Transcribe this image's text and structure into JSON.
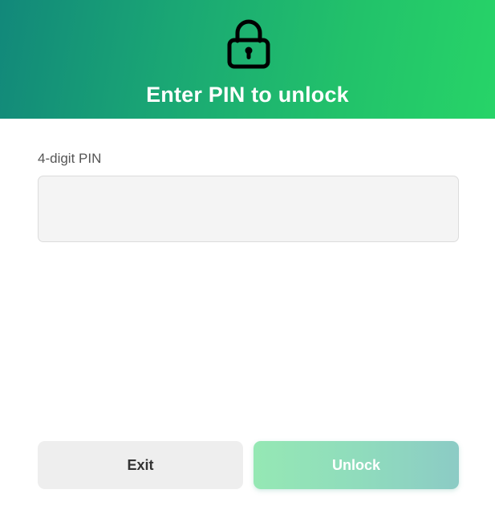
{
  "header": {
    "title": "Enter PIN to unlock",
    "icon": "lock-icon",
    "gradient_start": "#12887a",
    "gradient_end": "#27d468"
  },
  "pin_field": {
    "label": "4-digit PIN",
    "value": "",
    "placeholder": ""
  },
  "actions": {
    "exit_label": "Exit",
    "unlock_label": "Unlock",
    "unlock_color": "#8fdbbd"
  }
}
